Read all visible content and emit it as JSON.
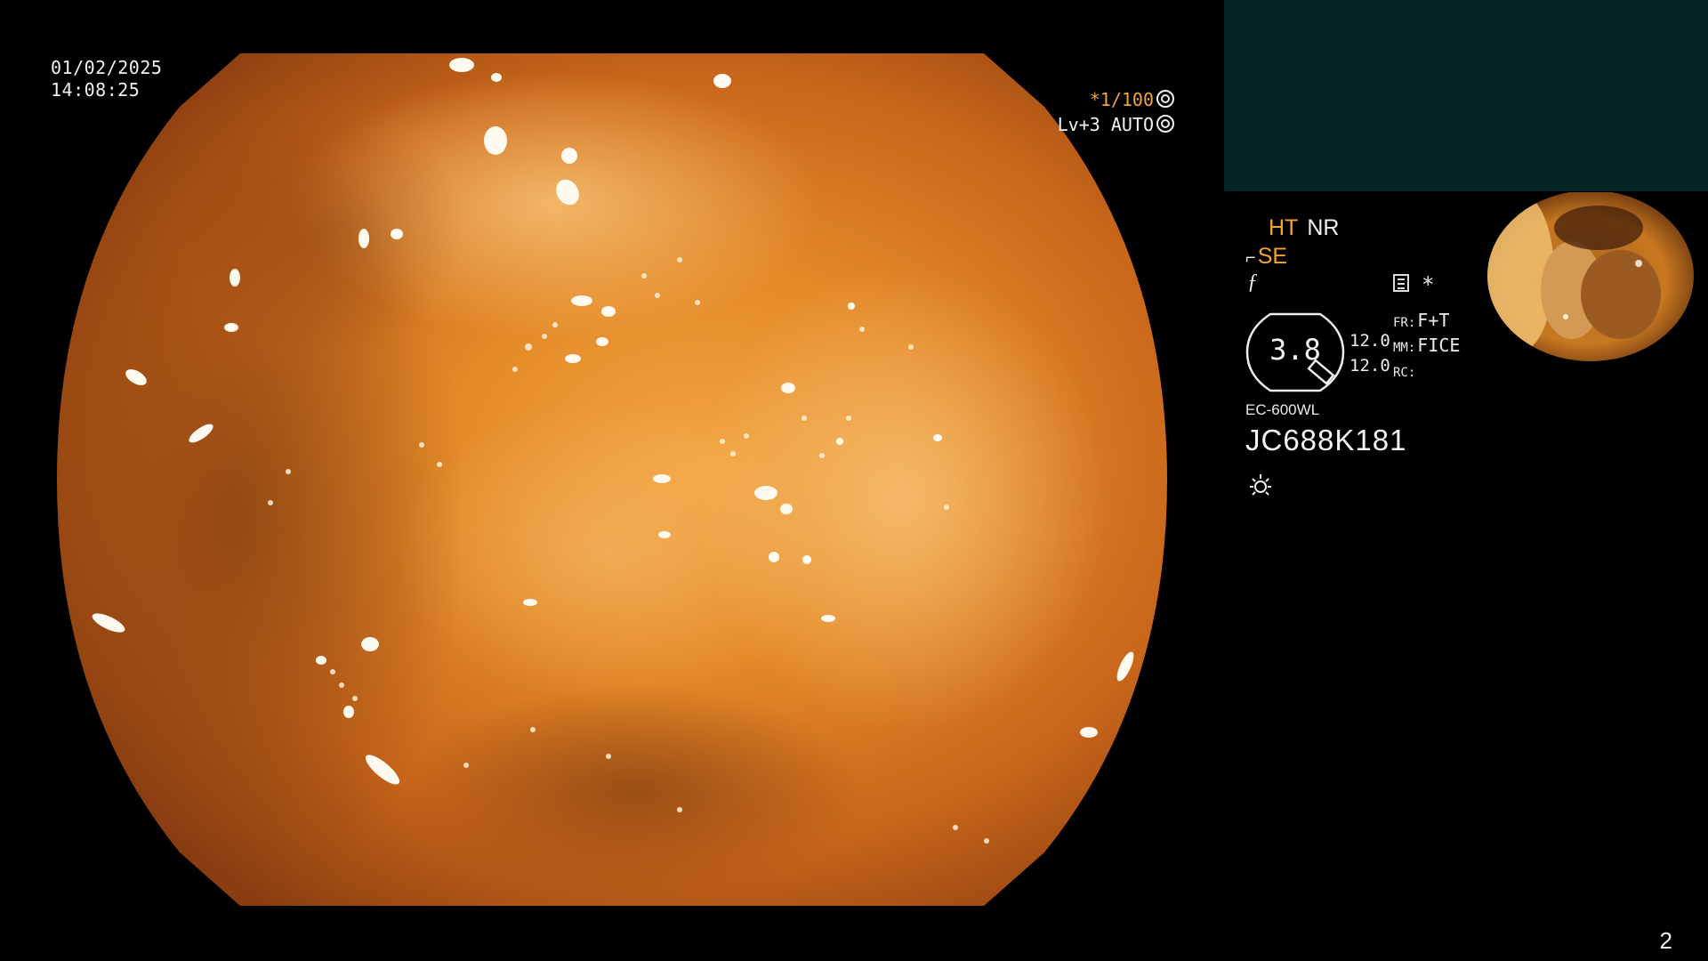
{
  "overlay": {
    "date": "01/02/2025",
    "time": "14:08:25",
    "shutter_value": "*1/100",
    "exposure": "Lv+3 AUTO"
  },
  "panel": {
    "mode_ht": "HT",
    "mode_nr": "NR",
    "mode_se": "SE",
    "zoom_value": "3.8",
    "level_top": "12.0",
    "level_bottom": "12.0",
    "fr_label": "FR:",
    "fr_value": "F+T",
    "mm_label": "MM:",
    "mm_value": "FICE",
    "rc_label": "RC:",
    "model": "EC-600WL",
    "serial": "JC688K181"
  },
  "page_number": "2",
  "colors": {
    "accent_orange": "#f3a533",
    "teal_panel": "#052424",
    "mucosa_base": "#d97a1e"
  },
  "icons": [
    "shutter-icon",
    "exposure-icon",
    "hook-icon",
    "f-icon",
    "menu-icon",
    "star-icon",
    "zoom-gauge-icon",
    "sun-icon"
  ]
}
